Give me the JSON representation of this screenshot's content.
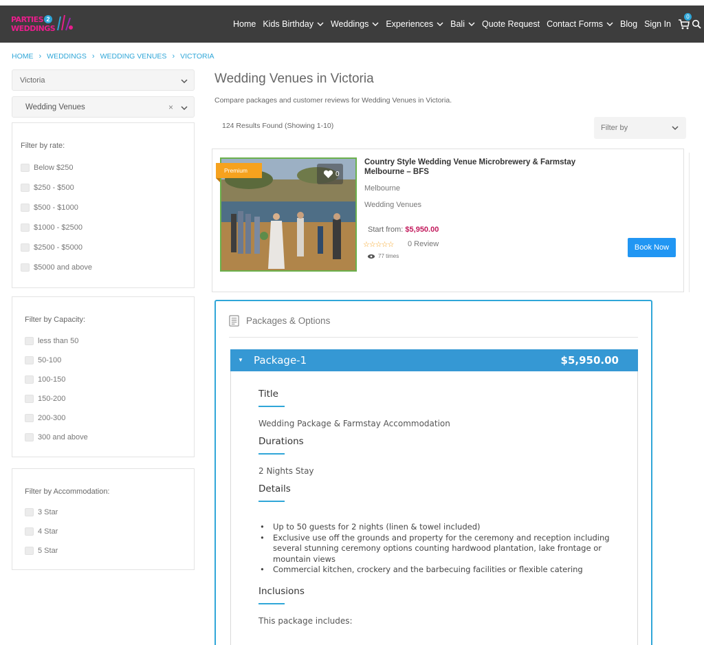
{
  "header": {
    "logo_line1": "PARTIES",
    "logo_badge": "2",
    "logo_line2": "WEDDINGS",
    "nav": [
      {
        "label": "Home",
        "dropdown": false
      },
      {
        "label": "Kids Birthday",
        "dropdown": true
      },
      {
        "label": "Weddings",
        "dropdown": true
      },
      {
        "label": "Experiences",
        "dropdown": true
      },
      {
        "label": "Bali",
        "dropdown": true
      },
      {
        "label": "Quote Request",
        "dropdown": false
      },
      {
        "label": "Contact Forms",
        "dropdown": true
      },
      {
        "label": "Blog",
        "dropdown": false
      },
      {
        "label": "Sign In",
        "dropdown": false
      }
    ],
    "cart_count": "0",
    "icons": [
      "cart-icon",
      "search-icon"
    ]
  },
  "breadcrumb": [
    "HOME",
    "WEDDINGS",
    "WEDDING VENUES",
    "VICTORIA"
  ],
  "sidebar": {
    "location_select": "Victoria",
    "category_select": "Wedding Venues",
    "clear_symbol": "×",
    "rate": {
      "title": "Filter by rate:",
      "options": [
        "Below $250",
        "$250 - $500",
        "$500 - $1000",
        "$1000 - $2500",
        "$2500 - $5000",
        "$5000 and above"
      ]
    },
    "capacity": {
      "title": "Filter by Capacity:",
      "options": [
        "less than 50",
        "50-100",
        "100-150",
        "150-200",
        "200-300",
        "300 and above"
      ]
    },
    "accommodation": {
      "title": "Filter by Accommodation:",
      "options": [
        "3 Star",
        "4 Star",
        "5 Star"
      ]
    }
  },
  "main": {
    "title": "Wedding Venues in Victoria",
    "subtitle": "Compare packages and customer reviews for Wedding Venues in Victoria.",
    "results": "124 Results Found (Showing 1-10)",
    "filter_by": "Filter by"
  },
  "listing": {
    "badge": "Premium",
    "likes": "0",
    "title": "Country Style Wedding Venue Microbrewery & Farmstay Melbourne – BFS",
    "location": "Melbourne",
    "category": "Wedding Venues",
    "start_label": "Start from:",
    "start_price": "$5,950.00",
    "stars": "☆☆☆☆☆",
    "reviews": "0 Review",
    "views": "77 times",
    "book_label": "Book Now",
    "colors": {
      "price": "#c2185b",
      "book": "#2196f3",
      "badge": "#f6a21e",
      "photo_border": "#6ab04c"
    }
  },
  "packages": {
    "heading": "Packages & Options",
    "package": {
      "arrow": "▼",
      "name": "Package-1",
      "price": "$5,950.00",
      "title_label": "Title",
      "title_value": "Wedding Package & Farmstay Accommodation",
      "durations_label": "Durations",
      "durations_value": "2 Nights Stay",
      "details_label": "Details",
      "details": [
        "Up to 50 guests for 2 nights (linen & towel included)",
        "Exclusive use off the grounds and property for the ceremony and reception including several stunning ceremony options counting hardwood plantation, lake frontage or mountain views",
        "Commercial kitchen, crockery and the barbecuing facilities or flexible catering"
      ],
      "inclusions_label": "Inclusions",
      "inclusions_value": "This package includes:"
    },
    "accent": "#3598d4"
  }
}
